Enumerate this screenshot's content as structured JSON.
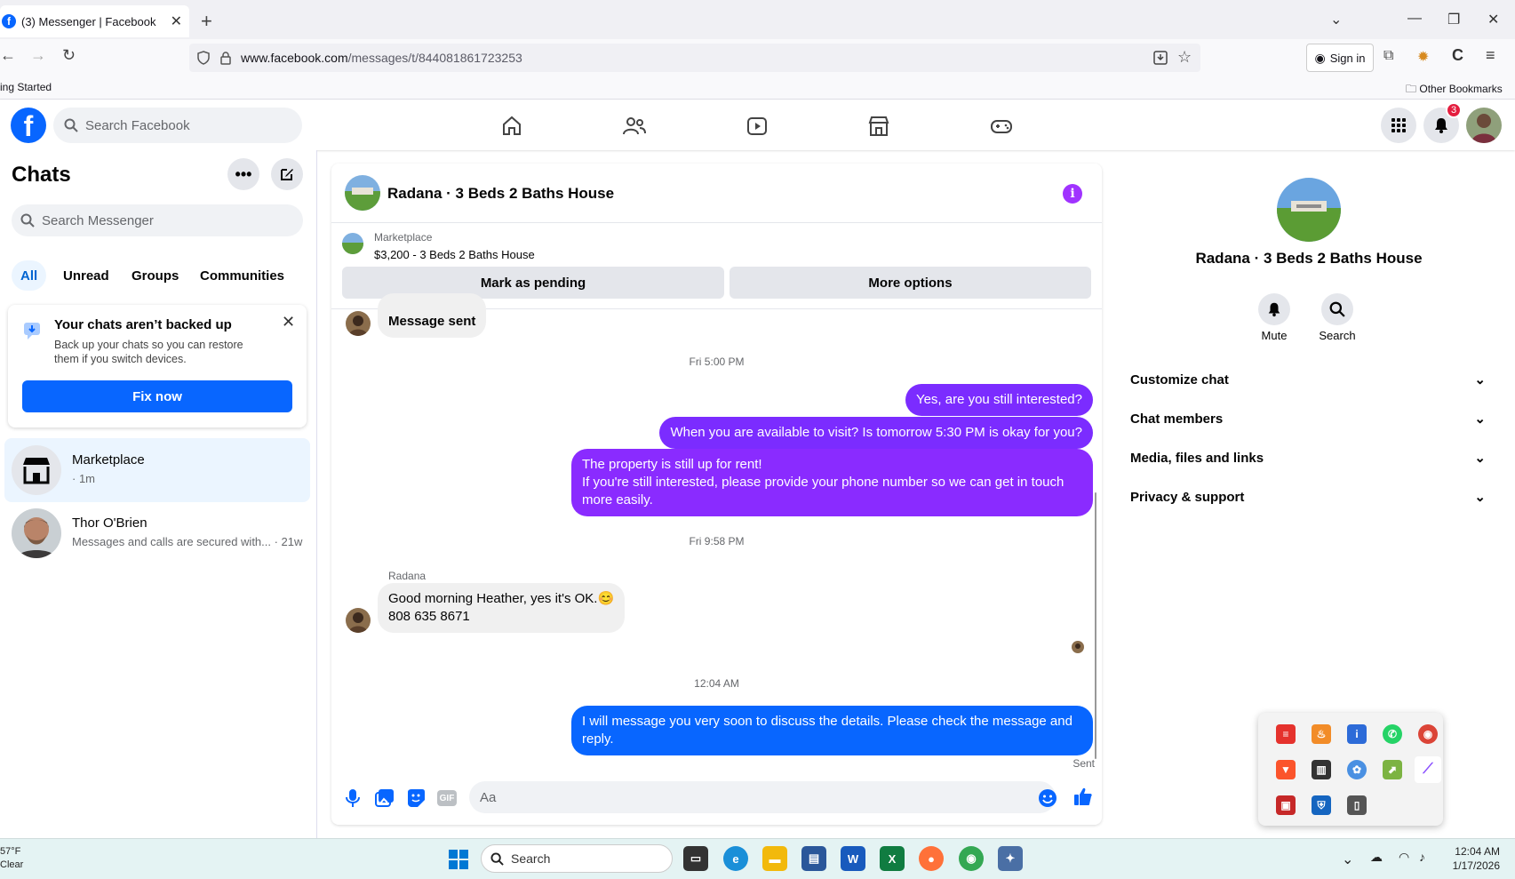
{
  "browser": {
    "tab_title": "(3) Messenger | Facebook",
    "url_host": "www.facebook.com",
    "url_path": "/messages/t/844081861723253",
    "sign_in": "Sign in",
    "bookmark_left": "ing Started",
    "bookmark_right": "Other Bookmarks"
  },
  "header": {
    "search_placeholder": "Search Facebook",
    "notification_count": "3"
  },
  "chats": {
    "title": "Chats",
    "search_placeholder": "Search Messenger",
    "filters": [
      "All",
      "Unread",
      "Groups",
      "Communities"
    ],
    "backup_title": "Your chats aren’t backed up",
    "backup_desc": "Back up your chats so you can restore them if you switch devices.",
    "backup_button": "Fix now",
    "items": [
      {
        "name": "Marketplace",
        "sub": "· 1m"
      },
      {
        "name": "Thor O'Brien",
        "sub": "Messages and calls are secured with... · 21w"
      }
    ]
  },
  "conversation": {
    "title": "Radana · 3 Beds 2 Baths House",
    "marketplace_label": "Marketplace",
    "listing": "$3,200 - 3 Beds 2 Baths House",
    "mark_pending": "Mark as pending",
    "more_options": "More options",
    "msg_sent": "Message sent",
    "ts1": "Fri 5:00 PM",
    "out1": "Yes, are you still interested?",
    "out2": "When you are available to visit? Is tomorrow 5:30 PM is okay for you?",
    "out3_line1": "The property is still up for rent!",
    "out3_line2": "If you're still interested, please provide your phone number so we can get in touch more easily.",
    "ts2": "Fri 9:58 PM",
    "sender": "Radana",
    "in1_line1": "Good morning Heather, yes it's OK.😊",
    "in1_line2": "808 635 8671",
    "ts3": "12:04 AM",
    "out4": "I will message you very soon to discuss the details. Please check the message and reply.",
    "sent_status": "Sent",
    "composer_placeholder": "Aa"
  },
  "info_panel": {
    "name": "Radana · 3 Beds 2 Baths House",
    "mute": "Mute",
    "search": "Search",
    "sections": [
      "Customize chat",
      "Chat members",
      "Media, files and links",
      "Privacy & support"
    ]
  },
  "taskbar": {
    "weather_temp": "57°F",
    "weather_cond": "Clear",
    "search": "Search",
    "time": "12:04 AM",
    "date": "1/17/2026"
  },
  "colors": {
    "fb_blue": "#0866ff",
    "purple_bubble": "#7b2cff",
    "info_purple": "#a033ff"
  }
}
